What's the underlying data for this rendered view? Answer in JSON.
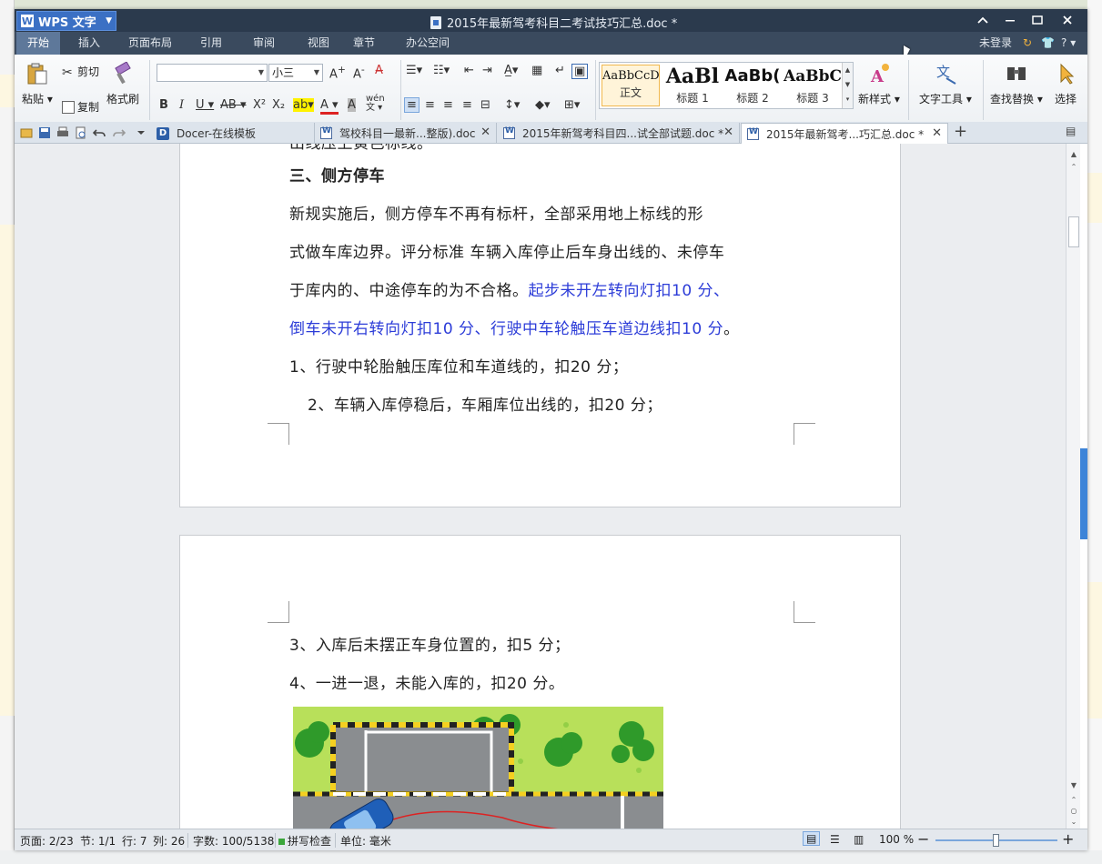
{
  "app": {
    "name": "WPS 文字",
    "title": "2015年最新驾考科目二考试技巧汇总.doc *"
  },
  "menu": {
    "items": [
      "开始",
      "插入",
      "页面布局",
      "引用",
      "审阅",
      "视图",
      "章节",
      "办公空间"
    ],
    "active": "开始",
    "login": "未登录",
    "help": "?"
  },
  "ribbon": {
    "paste": "粘贴",
    "cut": "剪切",
    "copy": "复制",
    "format_painter": "格式刷",
    "font_name": "",
    "font_size": "小三",
    "styles": [
      {
        "preview": "AaBbCcDd",
        "name": "正文"
      },
      {
        "preview": "AaBl",
        "name": "标题 1"
      },
      {
        "preview": "AaBb(",
        "name": "标题 2"
      },
      {
        "preview": "AaBbC",
        "name": "标题 3"
      }
    ],
    "new_style": "新样式",
    "text_tools": "文字工具",
    "find_replace": "查找替换",
    "select": "选择"
  },
  "tabs": [
    {
      "label": "Docer-在线模板",
      "active": false
    },
    {
      "label": "驾校科目一最新...整版).doc",
      "active": false
    },
    {
      "label": "2015年新驾考科目四...试全部试题.doc *",
      "active": false
    },
    {
      "label": "2015年最新驾考...巧汇总.doc *",
      "active": true
    }
  ],
  "document": {
    "page1_top_fragment": "出线压上黄色标线。",
    "heading": "三、侧方停车",
    "para1_line1": "新规实施后，侧方停车不再有标杆，全部采用地上标线的形",
    "para1_line2": "式做车库边界。评分标准   车辆入库停止后车身出线的、未停车",
    "para1_line3_black": "于库内的、中途停车的为不合格。",
    "para1_line3_blue": "起步未开左转向灯扣10 分、",
    "para1_line4_blue": "倒车未开右转向灯扣10 分、行驶中车轮触压车道边线扣10 分",
    "para1_line4_end": "。",
    "item1": "1、行驶中轮胎触压库位和车道线的，扣20 分；",
    "item2": "2、车辆入库停稳后，车厢库位出线的，扣20 分；",
    "item3": "3、入库后未摆正车身位置的，扣5 分；",
    "item4": "4、一进一退，未能入库的，扣20 分。"
  },
  "status": {
    "page": "页面: 2/23",
    "section": "节: 1/1",
    "row": "行: 7",
    "col": "列: 26",
    "words": "字数: 100/5138",
    "spellcheck": "拼写检查",
    "unit": "单位: 毫米",
    "zoom": "100 %",
    "zoom_level": 1.0
  },
  "colors": {
    "titlebar": "#2b3a4d",
    "accent": "#3b70c4",
    "blue_text": "#2c3cd8"
  }
}
